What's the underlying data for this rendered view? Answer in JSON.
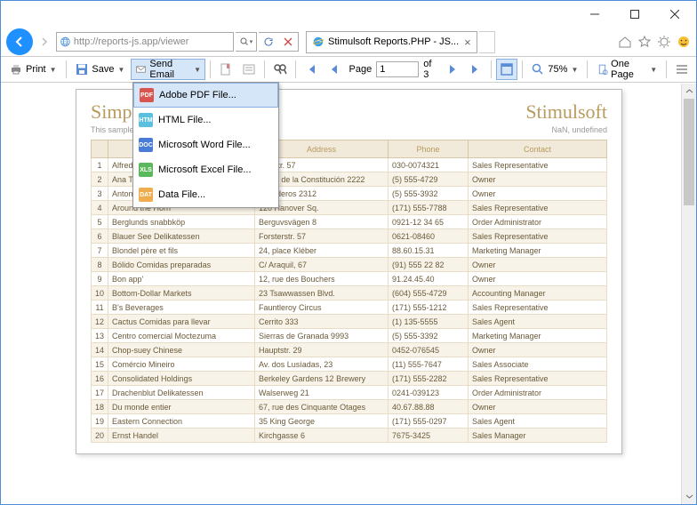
{
  "window": {
    "url": "http://reports-js.app/viewer",
    "tab_title": "Stimulsoft Reports.PHP - JS..."
  },
  "toolbar": {
    "print": "Print",
    "save": "Save",
    "send_email": "Send Email",
    "page_label": "Page",
    "page_current": "1",
    "page_total": "of 3",
    "zoom": "75%",
    "one_page": "One Page"
  },
  "dropdown": {
    "items": [
      {
        "icon_bg": "#d9534f",
        "icon_text": "PDF",
        "label": "Adobe PDF File..."
      },
      {
        "icon_bg": "#5bc0de",
        "icon_text": "HTM",
        "label": "HTML File..."
      },
      {
        "icon_bg": "#4a7bd6",
        "icon_text": "DOC",
        "label": "Microsoft Word File..."
      },
      {
        "icon_bg": "#5cb85c",
        "icon_text": "XLS",
        "label": "Microsoft Excel File..."
      },
      {
        "icon_bg": "#f0ad4e",
        "icon_text": "DAT",
        "label": "Data File..."
      }
    ]
  },
  "report": {
    "title": "Simpl",
    "subtitle": "This sample",
    "brand": "Stimulsoft",
    "nan": "NaN, undefined",
    "columns": [
      "",
      "",
      "Address",
      "Phone",
      "Contact"
    ],
    "rows": [
      [
        "1",
        "Alfreds",
        "ere Str. 57",
        "030-0074321",
        "Sales Representative"
      ],
      [
        "2",
        "Ana Trujillo Emparedados y helados",
        "Avda. de la Constitución 2222",
        "(5) 555-4729",
        "Owner"
      ],
      [
        "3",
        "Antonio Moreno Taquería",
        "Mataderos 2312",
        "(5) 555-3932",
        "Owner"
      ],
      [
        "4",
        "Around the Horn",
        "120 Hanover Sq.",
        "(171) 555-7788",
        "Sales Representative"
      ],
      [
        "5",
        "Berglunds snabbköp",
        "Berguvsvägen 8",
        "0921-12 34 65",
        "Order Administrator"
      ],
      [
        "6",
        "Blauer See Delikatessen",
        "Forsterstr. 57",
        "0621-08460",
        "Sales Representative"
      ],
      [
        "7",
        "Blondel père et fils",
        "24, place Kléber",
        "88.60.15.31",
        "Marketing Manager"
      ],
      [
        "8",
        "Bólido Comidas preparadas",
        "C/ Araquil, 67",
        "(91) 555 22 82",
        "Owner"
      ],
      [
        "9",
        "Bon app'",
        "12, rue des Bouchers",
        "91.24.45.40",
        "Owner"
      ],
      [
        "10",
        "Bottom-Dollar Markets",
        "23 Tsawwassen Blvd.",
        "(604) 555-4729",
        "Accounting Manager"
      ],
      [
        "11",
        "B's Beverages",
        "Fauntleroy Circus",
        "(171) 555-1212",
        "Sales Representative"
      ],
      [
        "12",
        "Cactus Comidas para llevar",
        "Cerrito 333",
        "(1) 135-5555",
        "Sales Agent"
      ],
      [
        "13",
        "Centro comercial Moctezuma",
        "Sierras de Granada 9993",
        "(5) 555-3392",
        "Marketing Manager"
      ],
      [
        "14",
        "Chop-suey Chinese",
        "Hauptstr. 29",
        "0452-076545",
        "Owner"
      ],
      [
        "15",
        "Comércio Mineiro",
        "Av. dos Lusíadas, 23",
        "(11) 555-7647",
        "Sales Associate"
      ],
      [
        "16",
        "Consolidated Holdings",
        "Berkeley Gardens\n12 Brewery",
        "(171) 555-2282",
        "Sales Representative"
      ],
      [
        "17",
        "Drachenblut Delikatessen",
        "Walserweg 21",
        "0241-039123",
        "Order Administrator"
      ],
      [
        "18",
        "Du monde entier",
        "67, rue des Cinquante Otages",
        "40.67.88.88",
        "Owner"
      ],
      [
        "19",
        "Eastern Connection",
        "35 King George",
        "(171) 555-0297",
        "Sales Agent"
      ],
      [
        "20",
        "Ernst Handel",
        "Kirchgasse 6",
        "7675-3425",
        "Sales Manager"
      ]
    ]
  }
}
